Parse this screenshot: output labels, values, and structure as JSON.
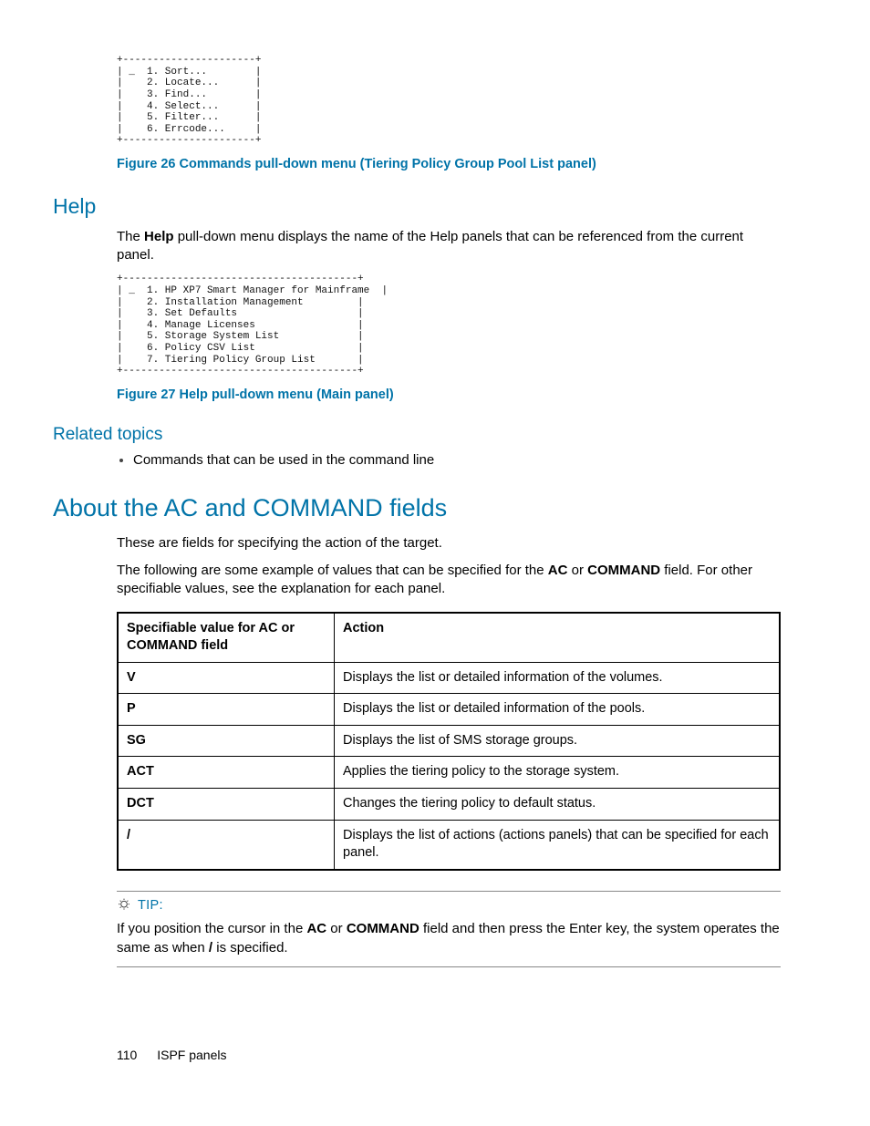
{
  "menu1": {
    "border_top": "+----------------------+",
    "lines": [
      "| _  1. Sort...        |",
      "|    2. Locate...      |",
      "|    3. Find...        |",
      "|    4. Select...      |",
      "|    5. Filter...      |",
      "|    6. Errcode...     |"
    ],
    "border_bot": "+----------------------+"
  },
  "fig26": "Figure 26 Commands pull-down menu (Tiering Policy Group Pool List panel)",
  "help_heading": "Help",
  "help_para_pre": "The ",
  "help_para_bold": "Help",
  "help_para_post": " pull-down menu displays the name of the Help panels that can be referenced from the current panel.",
  "menu2": {
    "border_top": "+---------------------------------------+",
    "lines": [
      "| _  1. HP XP7 Smart Manager for Mainframe  |",
      "|    2. Installation Management         |",
      "|    3. Set Defaults                    |",
      "|    4. Manage Licenses                 |",
      "|    5. Storage System List             |",
      "|    6. Policy CSV List                 |",
      "|    7. Tiering Policy Group List       |"
    ],
    "border_bot": "+---------------------------------------+"
  },
  "fig27": "Figure 27 Help pull-down menu (Main panel)",
  "related_heading": "Related topics",
  "related_item": "Commands that can be used in the command line",
  "about_heading": "About the AC and COMMAND fields",
  "about_p1": "These are fields for specifying the action of the target.",
  "about_p2_a": "The following are some example of values that can be specified for the ",
  "about_p2_b": "AC",
  "about_p2_c": " or ",
  "about_p2_d": "COMMAND",
  "about_p2_e": " field. For other specifiable values, see the explanation for each panel.",
  "table": {
    "h1": "Specifiable value for AC or COMMAND field",
    "h2": "Action",
    "rows": [
      {
        "v": "V",
        "a": "Displays the list or detailed information of the volumes."
      },
      {
        "v": "P",
        "a": "Displays the list or detailed information of the pools."
      },
      {
        "v": "SG",
        "a": "Displays the list of SMS storage groups."
      },
      {
        "v": "ACT",
        "a": "Applies the tiering policy to the storage system."
      },
      {
        "v": "DCT",
        "a": "Changes the tiering policy to default status."
      },
      {
        "v": "/",
        "a": "Displays the list of actions (actions panels) that can be specified for each panel."
      }
    ]
  },
  "tip_label": "TIP:",
  "tip_a": "If you position the cursor in the ",
  "tip_b": "AC",
  "tip_c": " or ",
  "tip_d": "COMMAND",
  "tip_e": " field and then press the Enter key, the system operates the same as when ",
  "tip_f": "/",
  "tip_g": " is specified.",
  "footer_page": "110",
  "footer_text": "ISPF panels"
}
